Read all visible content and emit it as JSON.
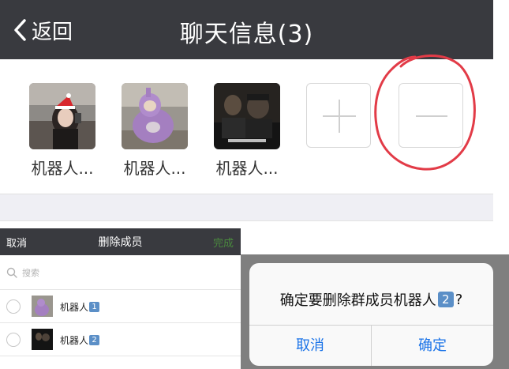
{
  "header": {
    "back_label": "返回",
    "title": "聊天信息(3)"
  },
  "members": [
    {
      "name": "机器人..."
    },
    {
      "name": "机器人..."
    },
    {
      "name": "机器人..."
    }
  ],
  "remove_screen": {
    "cancel_label": "取消",
    "title": "删除成员",
    "done_label": "完成",
    "search_placeholder": "搜索",
    "rows": [
      {
        "name": "机器人",
        "badge": "1"
      },
      {
        "name": "机器人",
        "badge": "2"
      }
    ]
  },
  "confirm_dialog": {
    "message_prefix": "确定要删除群成员机器人",
    "message_badge": "2",
    "message_suffix": "?",
    "cancel_label": "取消",
    "confirm_label": "确定"
  },
  "colors": {
    "header_bg": "#393a3f",
    "annotation_red": "#e23b47",
    "link_blue": "#1a73e8",
    "done_green": "#4a8a3e"
  }
}
